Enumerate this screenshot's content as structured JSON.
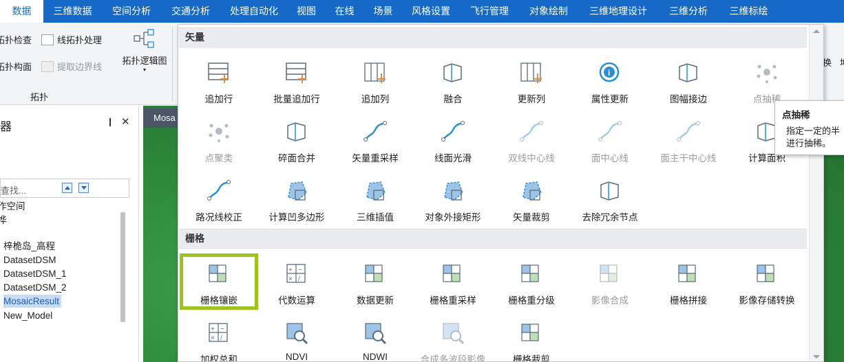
{
  "tabs": [
    "数据",
    "三维数据",
    "空间分析",
    "交通分析",
    "处理自动化",
    "视图",
    "在线",
    "场景",
    "风格设置",
    "飞行管理",
    "对象绘制",
    "三维地理设计",
    "三维分析",
    "三维标绘"
  ],
  "ribbon": {
    "topo_check": "拓扑检查",
    "topo_line": "线拓扑处理",
    "topo_face": "拓扑构面",
    "extract_boundary": "提取边界线",
    "topo_logic": "拓扑逻辑图",
    "group_label": "拓扑",
    "right_frag_1": "换",
    "right_frag_2": "坤"
  },
  "left_panel": {
    "title": "器",
    "pin": "❙",
    "close": "✕",
    "search_placeholder": "查找...",
    "tree": [
      "作空间",
      "桦",
      "梓桅岛_高程",
      "DatasetDSM",
      "DatasetDSM_1",
      "DatasetDSM_2",
      "MosaicResult",
      "New_Model"
    ],
    "selected": "MosaicResult"
  },
  "map_tab": "Mosa",
  "gallery": {
    "vector_header": "矢量",
    "raster_header": "栅格",
    "vector_items": [
      {
        "label": "追加行",
        "icon": "append-row-icon",
        "dim": false
      },
      {
        "label": "批量追加行",
        "icon": "batch-append-row-icon",
        "dim": false
      },
      {
        "label": "追加列",
        "icon": "append-column-icon",
        "dim": false
      },
      {
        "label": "融合",
        "icon": "dissolve-icon",
        "dim": false
      },
      {
        "label": "更新列",
        "icon": "update-column-icon",
        "dim": false
      },
      {
        "label": "属性更新",
        "icon": "attribute-update-icon",
        "dim": false
      },
      {
        "label": "图幅接边",
        "icon": "sheet-edge-match-icon",
        "dim": false
      },
      {
        "label": "点抽稀",
        "icon": "point-thinning-icon",
        "dim": true
      },
      {
        "label": "点聚类",
        "icon": "point-cluster-icon",
        "dim": true
      },
      {
        "label": "碎面合并",
        "icon": "fragment-merge-icon",
        "dim": false
      },
      {
        "label": "矢量重采样",
        "icon": "vector-resample-icon",
        "dim": false
      },
      {
        "label": "线面光滑",
        "icon": "smooth-icon",
        "dim": false
      },
      {
        "label": "双线中心线",
        "icon": "double-line-center-icon",
        "dim": true
      },
      {
        "label": "面中心线",
        "icon": "region-centerline-icon",
        "dim": true
      },
      {
        "label": "面主干中心线",
        "icon": "region-trunk-centerline-icon",
        "dim": true
      },
      {
        "label": "计算面积",
        "icon": "compute-area-icon",
        "dim": false
      },
      {
        "label": "路况线校正",
        "icon": "road-line-correct-icon",
        "dim": false
      },
      {
        "label": "计算凹多边形",
        "icon": "concave-polygon-icon",
        "dim": false
      },
      {
        "label": "三维插值",
        "icon": "3d-interpolation-icon",
        "dim": false
      },
      {
        "label": "对象外接矩形",
        "icon": "bounding-rect-icon",
        "dim": false
      },
      {
        "label": "矢量裁剪",
        "icon": "vector-clip-icon",
        "dim": false
      },
      {
        "label": "去除冗余节点",
        "icon": "remove-redundant-node-icon",
        "dim": false
      }
    ],
    "raster_items": [
      {
        "label": "栅格镶嵌",
        "icon": "raster-mosaic-icon",
        "dim": false,
        "highlight": true
      },
      {
        "label": "代数运算",
        "icon": "algebra-icon",
        "dim": false
      },
      {
        "label": "数据更新",
        "icon": "data-update-icon",
        "dim": false
      },
      {
        "label": "栅格重采样",
        "icon": "raster-resample-icon",
        "dim": false
      },
      {
        "label": "栅格重分级",
        "icon": "raster-reclass-icon",
        "dim": false
      },
      {
        "label": "影像合成",
        "icon": "image-composite-icon",
        "dim": true
      },
      {
        "label": "栅格拼接",
        "icon": "raster-stitch-icon",
        "dim": false
      },
      {
        "label": "影像存储转换",
        "icon": "image-storage-convert-icon",
        "dim": false
      },
      {
        "label": "加权总和",
        "icon": "weighted-sum-icon",
        "dim": false
      },
      {
        "label": "NDVI",
        "icon": "ndvi-icon",
        "dim": false
      },
      {
        "label": "NDWI",
        "icon": "ndwi-icon",
        "dim": false
      },
      {
        "label": "合成多波段影像",
        "icon": "multiband-composite-icon",
        "dim": true
      },
      {
        "label": "栅格裁剪",
        "icon": "raster-clip-icon",
        "dim": false
      }
    ]
  },
  "tooltip": {
    "title": "点抽稀",
    "line1": "指定一定的半",
    "line2": "进行抽稀。"
  },
  "colors": {
    "accent": "#1769c7",
    "highlight": "#9cc41d",
    "icon_blue": "#2b8fd6",
    "icon_orange": "#e08a3c"
  }
}
